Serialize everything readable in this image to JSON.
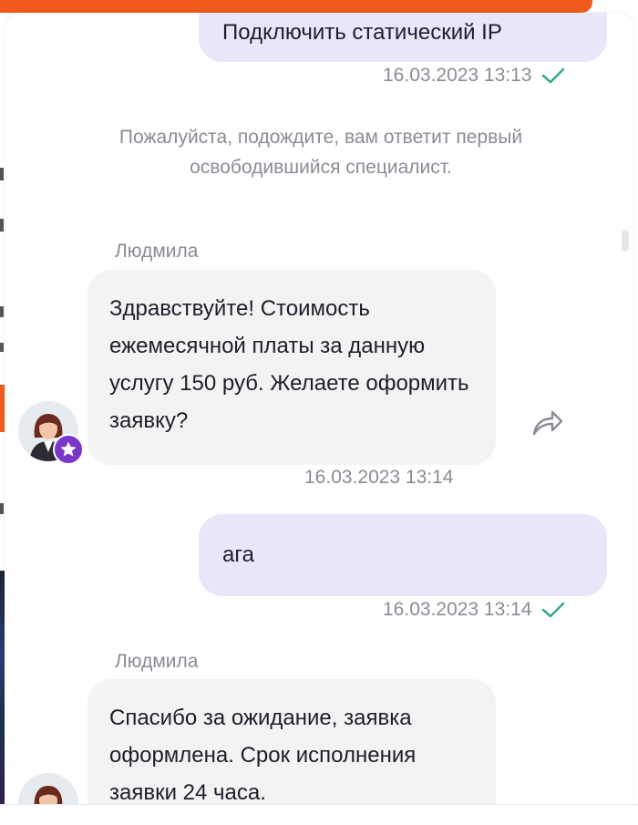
{
  "colors": {
    "accent_orange": "#f25a1d",
    "outgoing_bubble": "#e8e6f8",
    "incoming_bubble": "#f3f3f4",
    "meta_text": "#8b8b95",
    "check": "#3aa88f",
    "badge": "#7b35c9"
  },
  "messages": {
    "out1": {
      "text": "Подключить статический IP",
      "timestamp": "16.03.2023 13:13",
      "status_icon": "check-icon"
    },
    "system": {
      "text": "Пожалуйста, подождите, вам ответит первый освободившийся специалист."
    },
    "in1": {
      "sender": "Людмила",
      "text": "Здравствуйте! Стоимость ежемесячной платы за данную услугу 150 руб. Желаете оформить заявку?",
      "timestamp": "16.03.2023 13:14",
      "action_icon": "share-icon"
    },
    "out2": {
      "text": "ага",
      "timestamp": "16.03.2023 13:14",
      "status_icon": "check-icon"
    },
    "in2": {
      "sender": "Людмила",
      "text": "Спасибо за ожидание, заявка оформлена. Срок исполнения заявки 24 часа."
    }
  }
}
